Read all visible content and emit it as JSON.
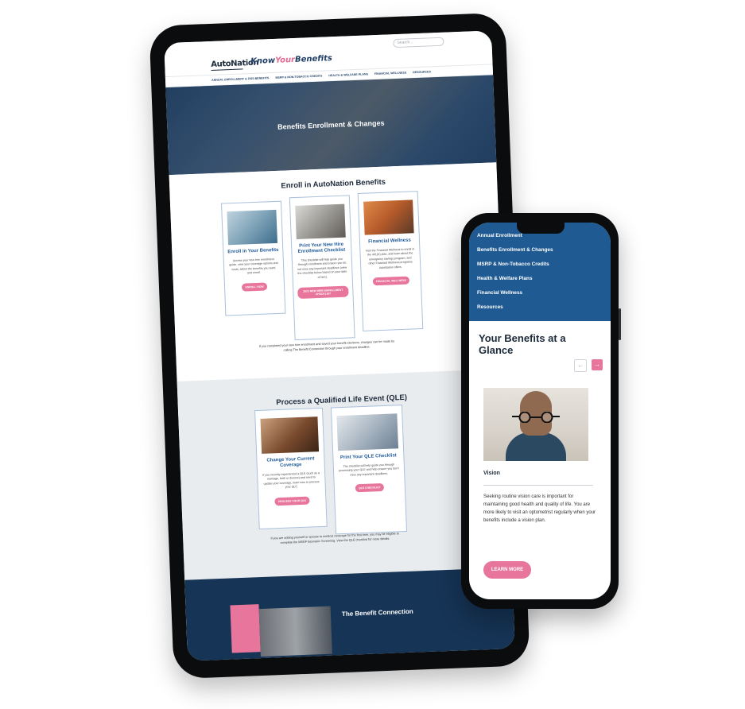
{
  "tablet": {
    "search_placeholder": "Search...",
    "logo": "AutoNation",
    "brand": {
      "know": "Know",
      "your": "Your",
      "benefits": "Benefits"
    },
    "nav": [
      "ANNUAL ENROLLMENT & 2023 BENEFITS",
      "MSRP & NON-TOBACCO CREDITS",
      "HEALTH & WELFARE PLANS",
      "FINANCIAL WELLNESS",
      "RESOURCES"
    ],
    "hero_title": "Benefits Enrollment & Changes",
    "enroll": {
      "heading": "Enroll in AutoNation Benefits",
      "cards": [
        {
          "title": "Enroll in Your Benefits",
          "body": "Access your new hire enrollment guide, view your coverage options and costs, select the benefits you want, and enroll.",
          "button": "ENROLL NOW"
        },
        {
          "title": "Print Your New Hire Enrollment Checklist",
          "body": "This checklist will help guide you through enrollment and ensure you do not miss any important deadlines (view the checklist below based on your date of hire).",
          "button": "2023 NEW HIRE ENROLLMENT CHECKLIST"
        },
        {
          "title": "Financial Wellness",
          "body": "Visit the Financial Wellness to enroll in the 401(K) plan, and learn about the emergency savings program, and other Financial Wellness programs AutoNation offers.",
          "button": "FINANCIAL WELLNESS"
        }
      ],
      "note": "If you completed your new hire enrollment and saved your benefit elections, changes can be made by calling The Benefit Connection through your enrollment deadline."
    },
    "qle": {
      "heading": "Process a Qualified Life Event (QLE)",
      "cards": [
        {
          "title": "Change Your Current Coverage",
          "body": "If you recently experienced a QLE (such as a marriage, birth or divorce) and need to update your coverage, learn now to process your QLE.",
          "button": "PROCESS YOUR QLE"
        },
        {
          "title": "Print Your QLE Checklist",
          "body": "The checklist will help guide you through processing your QLE and help ensure you don't miss any important deadlines.",
          "button": "QLE CHECKLIST"
        }
      ],
      "note": "If you are adding yourself or spouse to medical coverage for the first time, you may be eligible to complete the MSRP Biometric Screening. View the QLE checklist for more details."
    },
    "footer_title": "The Benefit Connection"
  },
  "phone": {
    "nav": [
      "Annual Enrollment",
      "Benefits Enrollment & Changes",
      "MSRP & Non-Tobacco Credits",
      "Health & Welfare Plans",
      "Financial Wellness",
      "Resources"
    ],
    "title": "Your Benefits at a Glance",
    "prev_icon": "←",
    "next_icon": "→",
    "card_title": "Vision",
    "card_desc": "Seeking routine vision care is important for maintaining good health and quality of life. You are more likely to visit an optometrist regularly when your benefits include a vision plan.",
    "button": "LEARN MORE"
  }
}
